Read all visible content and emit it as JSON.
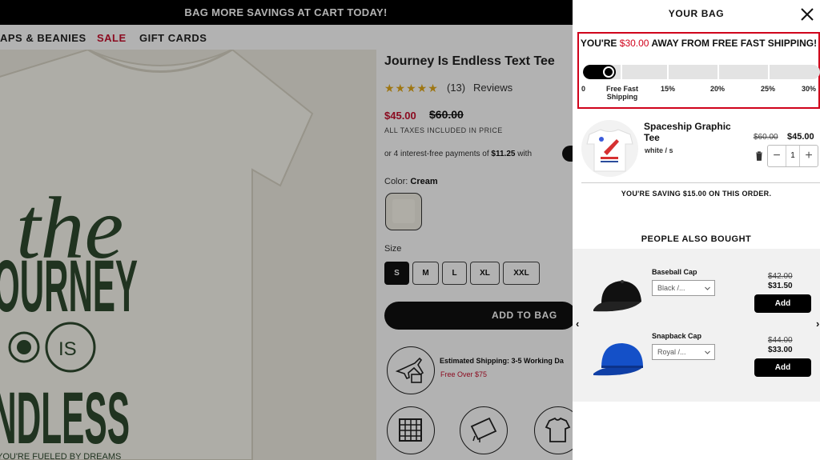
{
  "promo": {
    "text": "BAG MORE SAVINGS AT CART TODAY!"
  },
  "nav": {
    "items": [
      "APS & BEANIES",
      "SALE",
      "GIFT CARDS"
    ]
  },
  "product": {
    "title": "Journey Is Endless Text Tee",
    "rating_count": "(13)",
    "reviews_label": "Reviews",
    "stars": "★★★★★",
    "rating": 5,
    "sale_price": "$45.00",
    "regular_price": "$60.00",
    "tax_note": "ALL TAXES INCLUDED IN PRICE",
    "installments_prefix": "or 4 interest-free payments of",
    "installments_amount": "$11.25",
    "installments_suffix": "with",
    "color_label": "Color:",
    "color_value": "Cream",
    "size_label": "Size",
    "sizes": [
      "S",
      "M",
      "L",
      "XL",
      "XXL"
    ],
    "selected_size": "S",
    "add_to_bag": "ADD TO BAG",
    "shipping_text": "Estimated Shipping: 3-5 Working Da",
    "shipping_free": "Free Over $75",
    "hero_text": {
      "the": "the",
      "journey": "OURNEY",
      "is": "IS",
      "endless": "NDLESS",
      "fueled": "YOU'RE FUELED BY DREAMS"
    }
  },
  "cart": {
    "title": "YOUR BAG",
    "shipping_msg_prefix": "YOU'RE",
    "shipping_msg_amount": "$30.00",
    "shipping_msg_suffix": "AWAY FROM FREE FAST SHIPPING!",
    "progress_fraction": 0.11,
    "ticks": [
      "0",
      "Free Fast Shipping",
      "15%",
      "20%",
      "25%",
      "30%"
    ],
    "item": {
      "name": "Spaceship Graphic Tee",
      "variant": "white / s",
      "old_price": "$60.00",
      "price": "$45.00",
      "qty": "1",
      "minus": "−",
      "plus": "+"
    },
    "saving_prefix": "YOU'RE SAVING",
    "saving_amount": "$15.00",
    "saving_suffix": "ON THIS ORDER.",
    "people_also_bought": "PEOPLE ALSO BOUGHT",
    "recs": [
      {
        "name": "Baseball Cap",
        "option": "Black /...",
        "old_price": "$42.00",
        "price": "$31.50",
        "add": "Add"
      },
      {
        "name": "Snapback Cap",
        "option": "Royal /...",
        "old_price": "$44.00",
        "price": "$33.00",
        "add": "Add"
      }
    ],
    "arrow_left": "‹",
    "arrow_right": "›"
  },
  "colors": {
    "accent_red": "#d0021b",
    "sale_red": "#c8102e",
    "hero_green": "#2f4a2f",
    "cream": "#f0ede2"
  }
}
